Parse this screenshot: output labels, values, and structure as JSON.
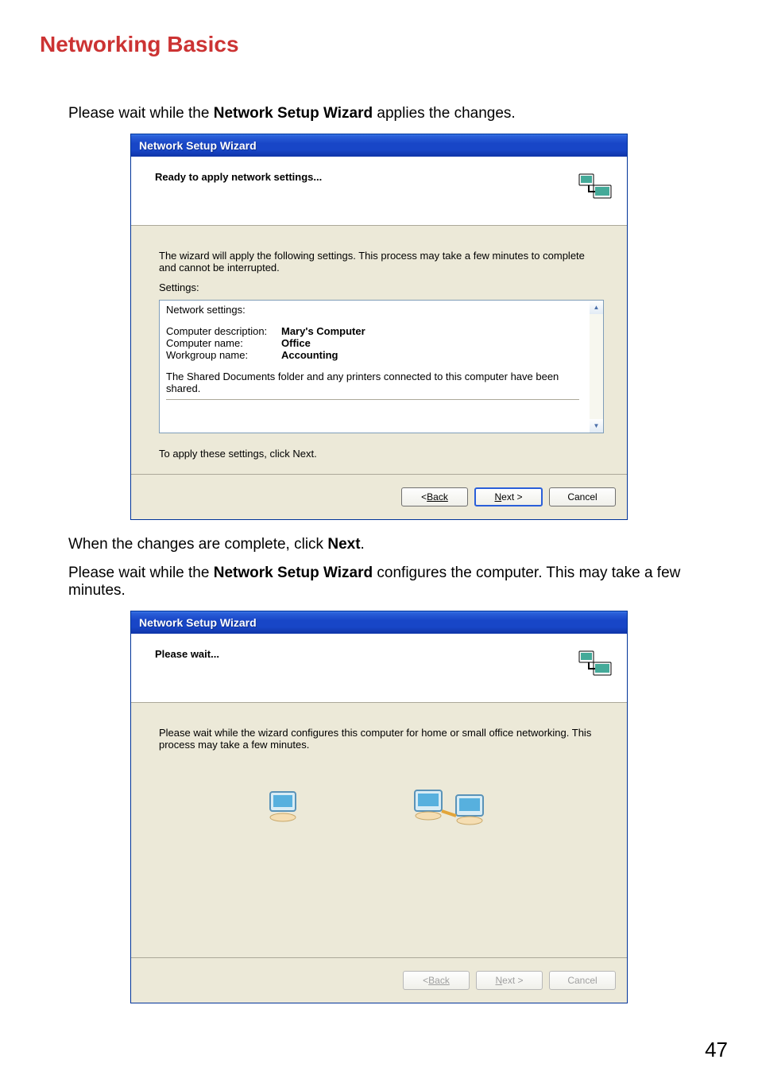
{
  "page": {
    "heading": "Networking Basics",
    "intro_pre": "Please wait while the ",
    "intro_bold": "Network Setup Wizard",
    "intro_post": " applies the changes.",
    "mid1": "When the changes are complete, click ",
    "mid1_bold": "Next",
    "mid1_post": ".",
    "intro2_pre": "Please wait while the ",
    "intro2_bold": "Network Setup Wizard",
    "intro2_post": " configures the computer. This may take a few minutes.",
    "page_number": "47"
  },
  "wizard1": {
    "title": "Network Setup Wizard",
    "header": "Ready to apply network settings...",
    "desc": "The wizard will apply the following settings. This process may take a few minutes to complete and cannot be interrupted.",
    "settings_label": "Settings:",
    "box": {
      "heading": "Network settings:",
      "rows": [
        {
          "k": "Computer description:",
          "v": "Mary's Computer"
        },
        {
          "k": "Computer name:",
          "v": "Office"
        },
        {
          "k": "Workgroup name:",
          "v": "Accounting"
        }
      ],
      "shared": "The Shared Documents folder and any printers connected to this computer have been shared."
    },
    "apply_hint": "To apply these settings, click Next.",
    "buttons": {
      "back": "Back",
      "next": "Next >",
      "cancel": "Cancel"
    }
  },
  "wizard2": {
    "title": "Network Setup Wizard",
    "header": "Please wait...",
    "desc": "Please wait while the wizard configures this computer for home or small office networking. This process may take a few minutes.",
    "buttons": {
      "back": "Back",
      "next": "Next >",
      "cancel": "Cancel"
    }
  }
}
